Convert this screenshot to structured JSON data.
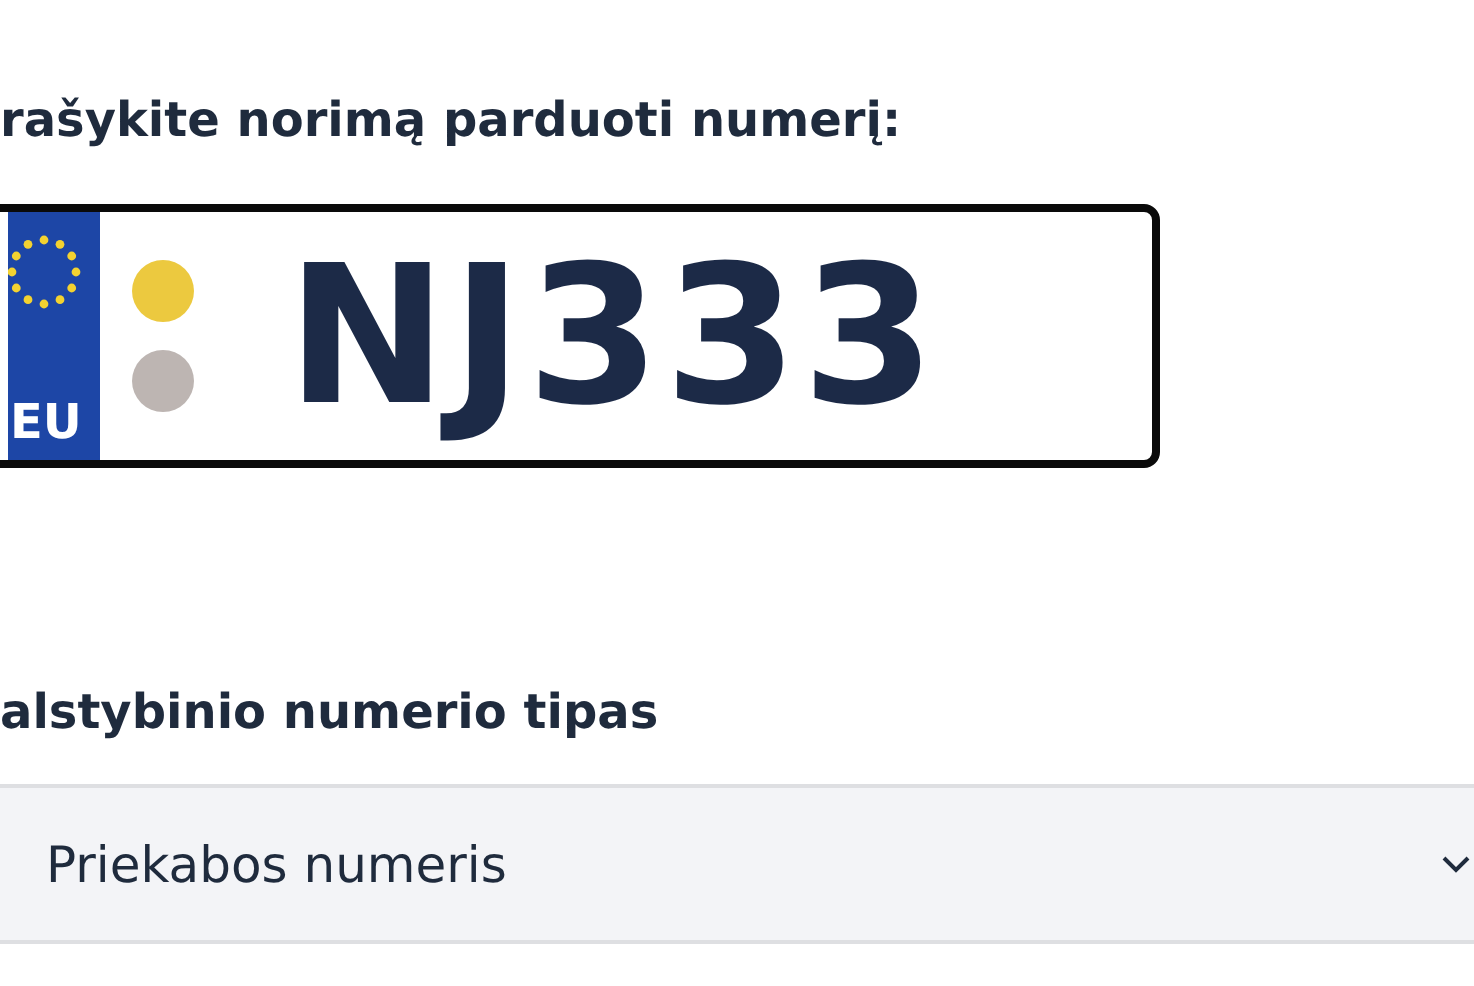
{
  "plate_prompt": "rašykite norimą parduoti numerį:",
  "plate": {
    "country": "EU",
    "number": "NJ333",
    "dots": [
      {
        "color": "#ecc93f"
      },
      {
        "color": "#bdb5b2"
      }
    ]
  },
  "type_label": "alstybinio numerio tipas",
  "type_select": {
    "value": "Priekabos numeris"
  }
}
